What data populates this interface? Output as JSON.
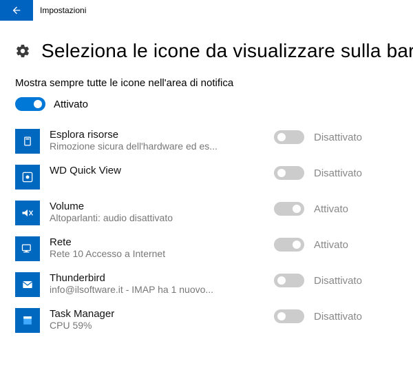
{
  "window": {
    "title": "Impostazioni"
  },
  "page": {
    "title": "Seleziona le icone da visualizzare sulla barra",
    "subtitle": "Mostra sempre tutte le icone nell'area di notifica",
    "master_toggle": {
      "on": true,
      "label": "Attivato"
    }
  },
  "items": [
    {
      "id": "explorer",
      "title": "Esplora risorse",
      "sub": "Rimozione sicura dell'hardware ed es...",
      "on": false,
      "status": "Disattivato"
    },
    {
      "id": "wdquickview",
      "title": "WD Quick View",
      "sub": "",
      "on": false,
      "status": "Disattivato"
    },
    {
      "id": "volume",
      "title": "Volume",
      "sub": "Altoparlanti: audio disattivato",
      "on": true,
      "status": "Attivato"
    },
    {
      "id": "network",
      "title": "Rete",
      "sub": "Rete  10 Accesso a Internet",
      "on": true,
      "status": "Attivato"
    },
    {
      "id": "thunderbird",
      "title": "Thunderbird",
      "sub": "info@ilsoftware.it - IMAP ha 1 nuovo...",
      "on": false,
      "status": "Disattivato"
    },
    {
      "id": "taskmgr",
      "title": "Task Manager",
      "sub": "CPU 59%",
      "on": false,
      "status": "Disattivato"
    }
  ]
}
